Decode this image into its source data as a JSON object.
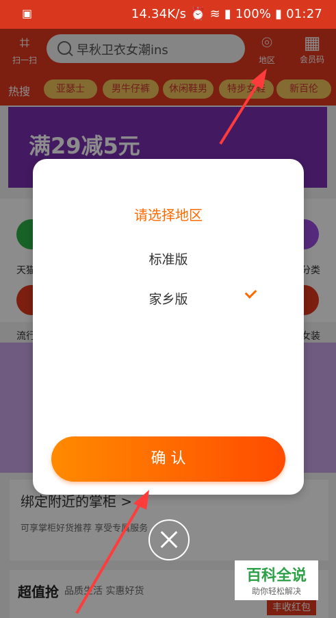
{
  "status_bar": {
    "speed": "14.34K/s",
    "battery": "100%",
    "time": "01:27"
  },
  "header": {
    "scan_label": "扫一扫",
    "search_placeholder": "早秋卫衣女潮ins",
    "region_label": "地区",
    "member_label": "会员码",
    "hot_label": "热搜",
    "hot_tags": [
      "亚瑟士",
      "男牛仔裤",
      "休闲鞋男",
      "特步女鞋",
      "新百伦"
    ]
  },
  "banner": {
    "promo": "满29减5元"
  },
  "background": {
    "categories": [
      "天猫",
      "分类",
      "流行",
      "女装"
    ],
    "bind_title": "绑定附近的掌柜 >",
    "bind_sub": "可享掌柜好货推荐 享受专属服务",
    "section_title": "超值抢",
    "section_sub": "品质生活 实惠好货",
    "badge": "丰收红包"
  },
  "dialog": {
    "title": "请选择地区",
    "options": [
      {
        "label": "标准版",
        "selected": false
      },
      {
        "label": "家乡版",
        "selected": true
      }
    ],
    "confirm_label": "确 认"
  },
  "watermark": {
    "title": "百科全说",
    "subtitle": "助你轻松解决"
  },
  "colors": {
    "brand": "#e23a1e",
    "accent": "#ff6a00"
  }
}
